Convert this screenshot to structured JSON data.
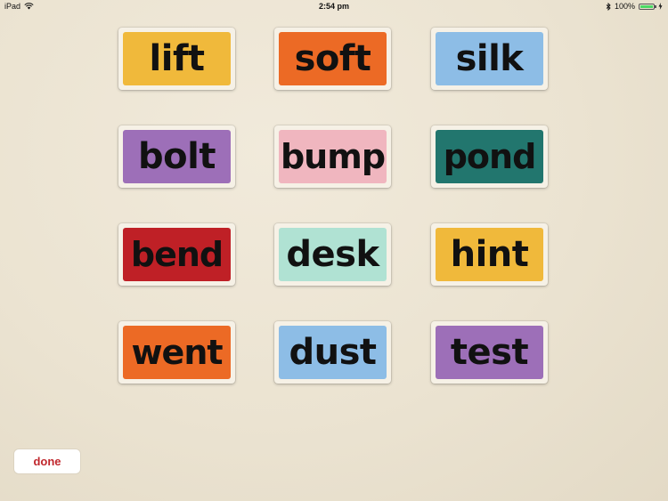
{
  "status_bar": {
    "device": "iPad",
    "time": "2:54 pm",
    "battery_percent": "100%",
    "battery_level": 1.0
  },
  "cards": [
    {
      "word": "lift",
      "color": "#f0b93b"
    },
    {
      "word": "soft",
      "color": "#ec6a25"
    },
    {
      "word": "silk",
      "color": "#8dbde6"
    },
    {
      "word": "bolt",
      "color": "#9d6fb8"
    },
    {
      "word": "bump",
      "color": "#f0b6bf"
    },
    {
      "word": "pond",
      "color": "#22766e"
    },
    {
      "word": "bend",
      "color": "#bf2026"
    },
    {
      "word": "desk",
      "color": "#b0e2d3"
    },
    {
      "word": "hint",
      "color": "#f0b93b"
    },
    {
      "word": "went",
      "color": "#ec6a25"
    },
    {
      "word": "dust",
      "color": "#8dbde6"
    },
    {
      "word": "test",
      "color": "#9d6fb8"
    }
  ],
  "done_button": {
    "label": "done",
    "color": "#c0272d"
  }
}
